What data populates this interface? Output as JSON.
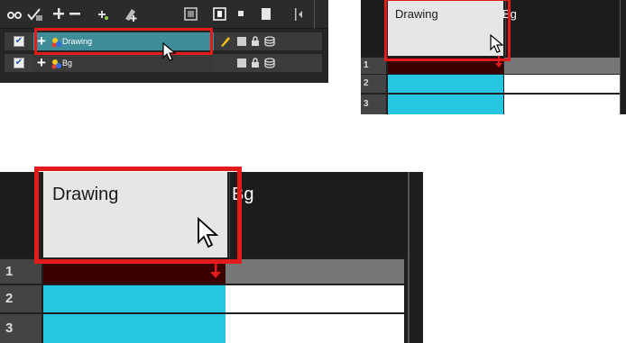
{
  "layer_panel": {
    "toolbar_icons": [
      "show-all-icon",
      "enable-all-icon",
      "add-layer-icon",
      "remove-layer-icon",
      "add-peg-icon",
      "add-drawing-icon",
      "lock-all-icon",
      "colour-icon",
      "small-square-icon",
      "large-square-icon"
    ],
    "toolbar_glyphs": {
      "show_all": "👁",
      "add_remove": "+, −"
    },
    "layers": [
      {
        "name": "Drawing",
        "checked": true,
        "selected": true
      },
      {
        "name": "Bg",
        "checked": true,
        "selected": false
      }
    ],
    "checkmark": "✔"
  },
  "xsheet_small": {
    "columns": [
      "Drawing",
      "Bg"
    ],
    "rows": [
      "1",
      "2",
      "3"
    ]
  },
  "xsheet_large": {
    "columns": [
      "Drawing",
      "Bg"
    ],
    "rows": [
      "1",
      "2",
      "3"
    ]
  },
  "colors": {
    "selected_layer": "#3f8d99",
    "highlight_red": "#e31b1b",
    "frame_cyan": "#26c6e3",
    "current_frame": "#3a0000"
  }
}
